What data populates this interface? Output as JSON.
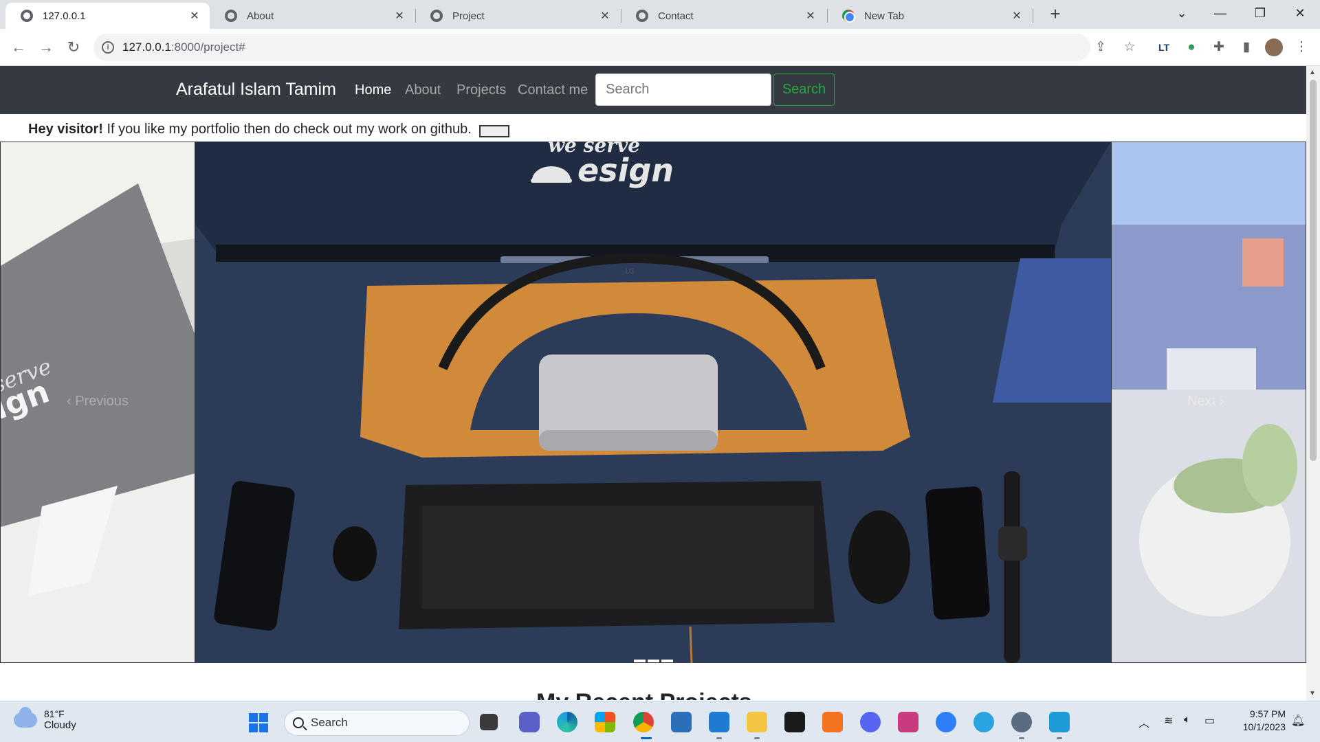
{
  "browser": {
    "tabs": [
      {
        "title": "127.0.0.1",
        "active": true,
        "favicon": "globe-icon"
      },
      {
        "title": "About",
        "active": false,
        "favicon": "globe-icon"
      },
      {
        "title": "Project",
        "active": false,
        "favicon": "globe-icon"
      },
      {
        "title": "Contact",
        "active": false,
        "favicon": "globe-icon"
      },
      {
        "title": "New Tab",
        "active": false,
        "favicon": "chrome-icon"
      }
    ],
    "url_host": "127.0.0.1",
    "url_path": ":8000/project#"
  },
  "site": {
    "brand": "Arafatul Islam Tamim",
    "nav": [
      {
        "label": "Home",
        "active": true
      },
      {
        "label": "About",
        "active": false
      },
      {
        "label": "Projects",
        "active": false
      },
      {
        "label": "Contact me",
        "active": false
      }
    ],
    "search_placeholder": "Search",
    "search_button": "Search",
    "alert_strong": "Hey visitor!",
    "alert_text": " If you like my portfolio then do check out my work on github.",
    "carousel": {
      "prev_label": "Previous",
      "next_label": "Next",
      "indicator_count": 3,
      "active_index": 0,
      "monitor_text": "we serve",
      "monitor_logo": "esign",
      "monitor_brand": "LG",
      "left_monitor_text": "serve",
      "left_monitor_logo": "ign"
    },
    "section_heading": "My Recent Projects"
  },
  "taskbar": {
    "weather_temp": "81°F",
    "weather_desc": "Cloudy",
    "search_label": "Search",
    "time": "9:57 PM",
    "date": "10/1/2023"
  },
  "colors": {
    "navbar_bg": "#343a40",
    "search_btn": "#28a745",
    "tabstrip_bg": "#dee1e6",
    "taskbar_bg": "#dfe7f1"
  }
}
